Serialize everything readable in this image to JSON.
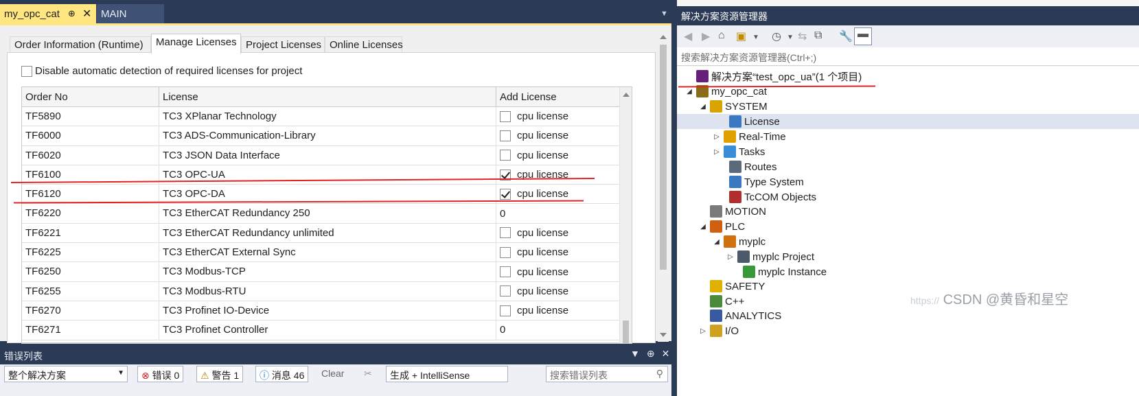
{
  "doc_tabs": {
    "active": {
      "label": "my_opc_cat",
      "pin": "⊕",
      "close": "✕"
    },
    "second": {
      "label": "MAIN"
    },
    "dropdown": "▼"
  },
  "inner_tabs": [
    "Order Information (Runtime)",
    "Manage Licenses",
    "Project Licenses",
    "Online Licenses"
  ],
  "disable_checkbox_label": "Disable automatic detection of required licenses for project",
  "grid": {
    "headers": [
      "Order No",
      "License",
      "Add License"
    ],
    "rows": [
      {
        "order": "TF5890",
        "license": "TC3 XPlanar Technology",
        "add": "cpu license",
        "checkbox": true,
        "checked": false
      },
      {
        "order": "TF6000",
        "license": "TC3 ADS-Communication-Library",
        "add": "cpu license",
        "checkbox": true,
        "checked": false
      },
      {
        "order": "TF6020",
        "license": "TC3 JSON Data Interface",
        "add": "cpu license",
        "checkbox": true,
        "checked": false
      },
      {
        "order": "TF6100",
        "license": "TC3 OPC-UA",
        "add": "cpu license",
        "checkbox": true,
        "checked": true
      },
      {
        "order": "TF6120",
        "license": "TC3 OPC-DA",
        "add": "cpu license",
        "checkbox": true,
        "checked": true
      },
      {
        "order": "TF6220",
        "license": "TC3 EtherCAT Redundancy 250",
        "add": "0",
        "checkbox": false,
        "checked": false
      },
      {
        "order": "TF6221",
        "license": "TC3 EtherCAT Redundancy unlimited",
        "add": "cpu license",
        "checkbox": true,
        "checked": false
      },
      {
        "order": "TF6225",
        "license": "TC3 EtherCAT External Sync",
        "add": "cpu license",
        "checkbox": true,
        "checked": false
      },
      {
        "order": "TF6250",
        "license": "TC3 Modbus-TCP",
        "add": "cpu license",
        "checkbox": true,
        "checked": false
      },
      {
        "order": "TF6255",
        "license": "TC3 Modbus-RTU",
        "add": "cpu license",
        "checkbox": true,
        "checked": false
      },
      {
        "order": "TF6270",
        "license": "TC3 Profinet IO-Device",
        "add": "cpu license",
        "checkbox": true,
        "checked": false
      },
      {
        "order": "TF6271",
        "license": "TC3 Profinet Controller",
        "add": "0",
        "checkbox": false,
        "checked": false
      }
    ]
  },
  "error_list": {
    "title": "错误列表",
    "tools": [
      "▼",
      "⊕",
      "✕"
    ],
    "scope": "整个解决方案",
    "errors": "错误 0",
    "warnings": "警告 1",
    "messages": "消息 46",
    "clear": "Clear",
    "build": "生成 + IntelliSense",
    "search_placeholder": "搜索错误列表"
  },
  "explorer": {
    "title": "解决方案资源管理器",
    "search_placeholder": "搜索解决方案资源管理器(Ctrl+;)",
    "tree": [
      {
        "label": "解决方案“test_opc_ua”(1 个项目)",
        "toggle": "",
        "icon": "solution-icon",
        "color": "#68217a"
      },
      {
        "label": "my_opc_cat",
        "toggle": "◢",
        "icon": "project-icon",
        "color": "#8a6d1a"
      },
      {
        "label": "SYSTEM",
        "toggle": "◢",
        "icon": "system-icon",
        "color": "#d9a400"
      },
      {
        "label": "License",
        "toggle": "",
        "icon": "license-icon",
        "color": "#3a78c2"
      },
      {
        "label": "Real-Time",
        "toggle": "▷",
        "icon": "realtime-icon",
        "color": "#e0a000"
      },
      {
        "label": "Tasks",
        "toggle": "▷",
        "icon": "tasks-icon",
        "color": "#3a8ed8"
      },
      {
        "label": "Routes",
        "toggle": "",
        "icon": "routes-icon",
        "color": "#5a6a7a"
      },
      {
        "label": "Type System",
        "toggle": "",
        "icon": "type-system-icon",
        "color": "#3a78c2"
      },
      {
        "label": "TcCOM Objects",
        "toggle": "",
        "icon": "tccom-icon",
        "color": "#b03030"
      },
      {
        "label": "MOTION",
        "toggle": "",
        "icon": "motion-icon",
        "color": "#7a7a7a"
      },
      {
        "label": "PLC",
        "toggle": "◢",
        "icon": "plc-icon",
        "color": "#d06010"
      },
      {
        "label": "myplc",
        "toggle": "◢",
        "icon": "myplc-icon",
        "color": "#d07010"
      },
      {
        "label": "myplc Project",
        "toggle": "▷",
        "icon": "plc-project-icon",
        "color": "#4a5a6a"
      },
      {
        "label": "myplc Instance",
        "toggle": "",
        "icon": "plc-instance-icon",
        "color": "#3a9a3a"
      },
      {
        "label": "SAFETY",
        "toggle": "",
        "icon": "safety-icon",
        "color": "#e0b000"
      },
      {
        "label": "C++",
        "toggle": "",
        "icon": "cpp-icon",
        "color": "#4a8a3a"
      },
      {
        "label": "ANALYTICS",
        "toggle": "",
        "icon": "analytics-icon",
        "color": "#3a5aa0"
      },
      {
        "label": "I/O",
        "toggle": "▷",
        "icon": "io-icon",
        "color": "#d0a020"
      }
    ]
  },
  "watermark": {
    "faint": "https://",
    "text": "CSDN @黄昏和星空"
  },
  "colors": {
    "accent_tab": "#ffe680",
    "chrome": "#2b3a55",
    "annotation": "#e02424",
    "selection": "#dde3ef"
  }
}
